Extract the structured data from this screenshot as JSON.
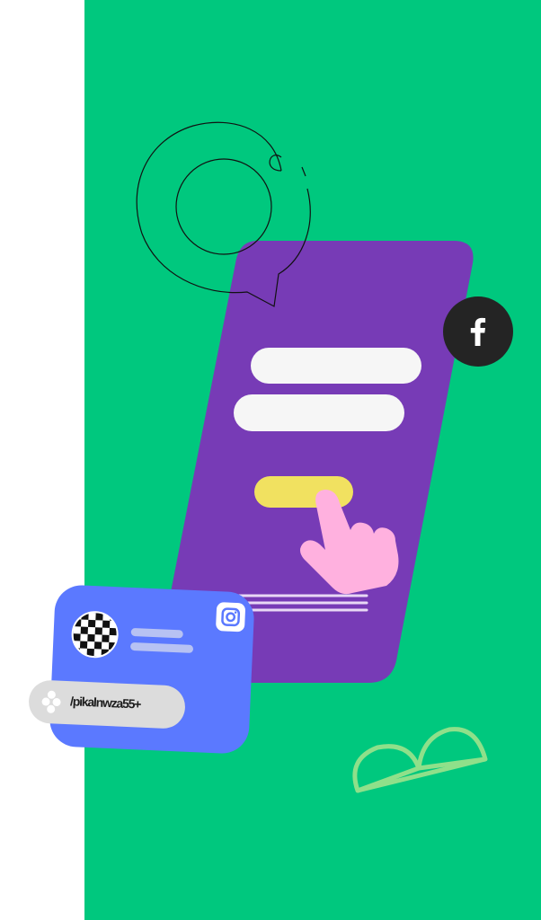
{
  "username": "/pikalnwza55+",
  "icons": {
    "social_network": "facebook-icon",
    "photo_network": "instagram-icon",
    "pointer": "pointing-hand-icon",
    "chat": "chat-bubble-icon",
    "decoration": "leaf-outline-icon"
  },
  "colors": {
    "background_panel": "#00c87e",
    "phone": "#773bb6",
    "input_fields": "#f6f6f6",
    "submit_button": "#f1e160",
    "hand": "#ffb1df",
    "social_card": "#5b79ff",
    "facebook_badge": "#242424",
    "leaf": "#8fe08a"
  }
}
